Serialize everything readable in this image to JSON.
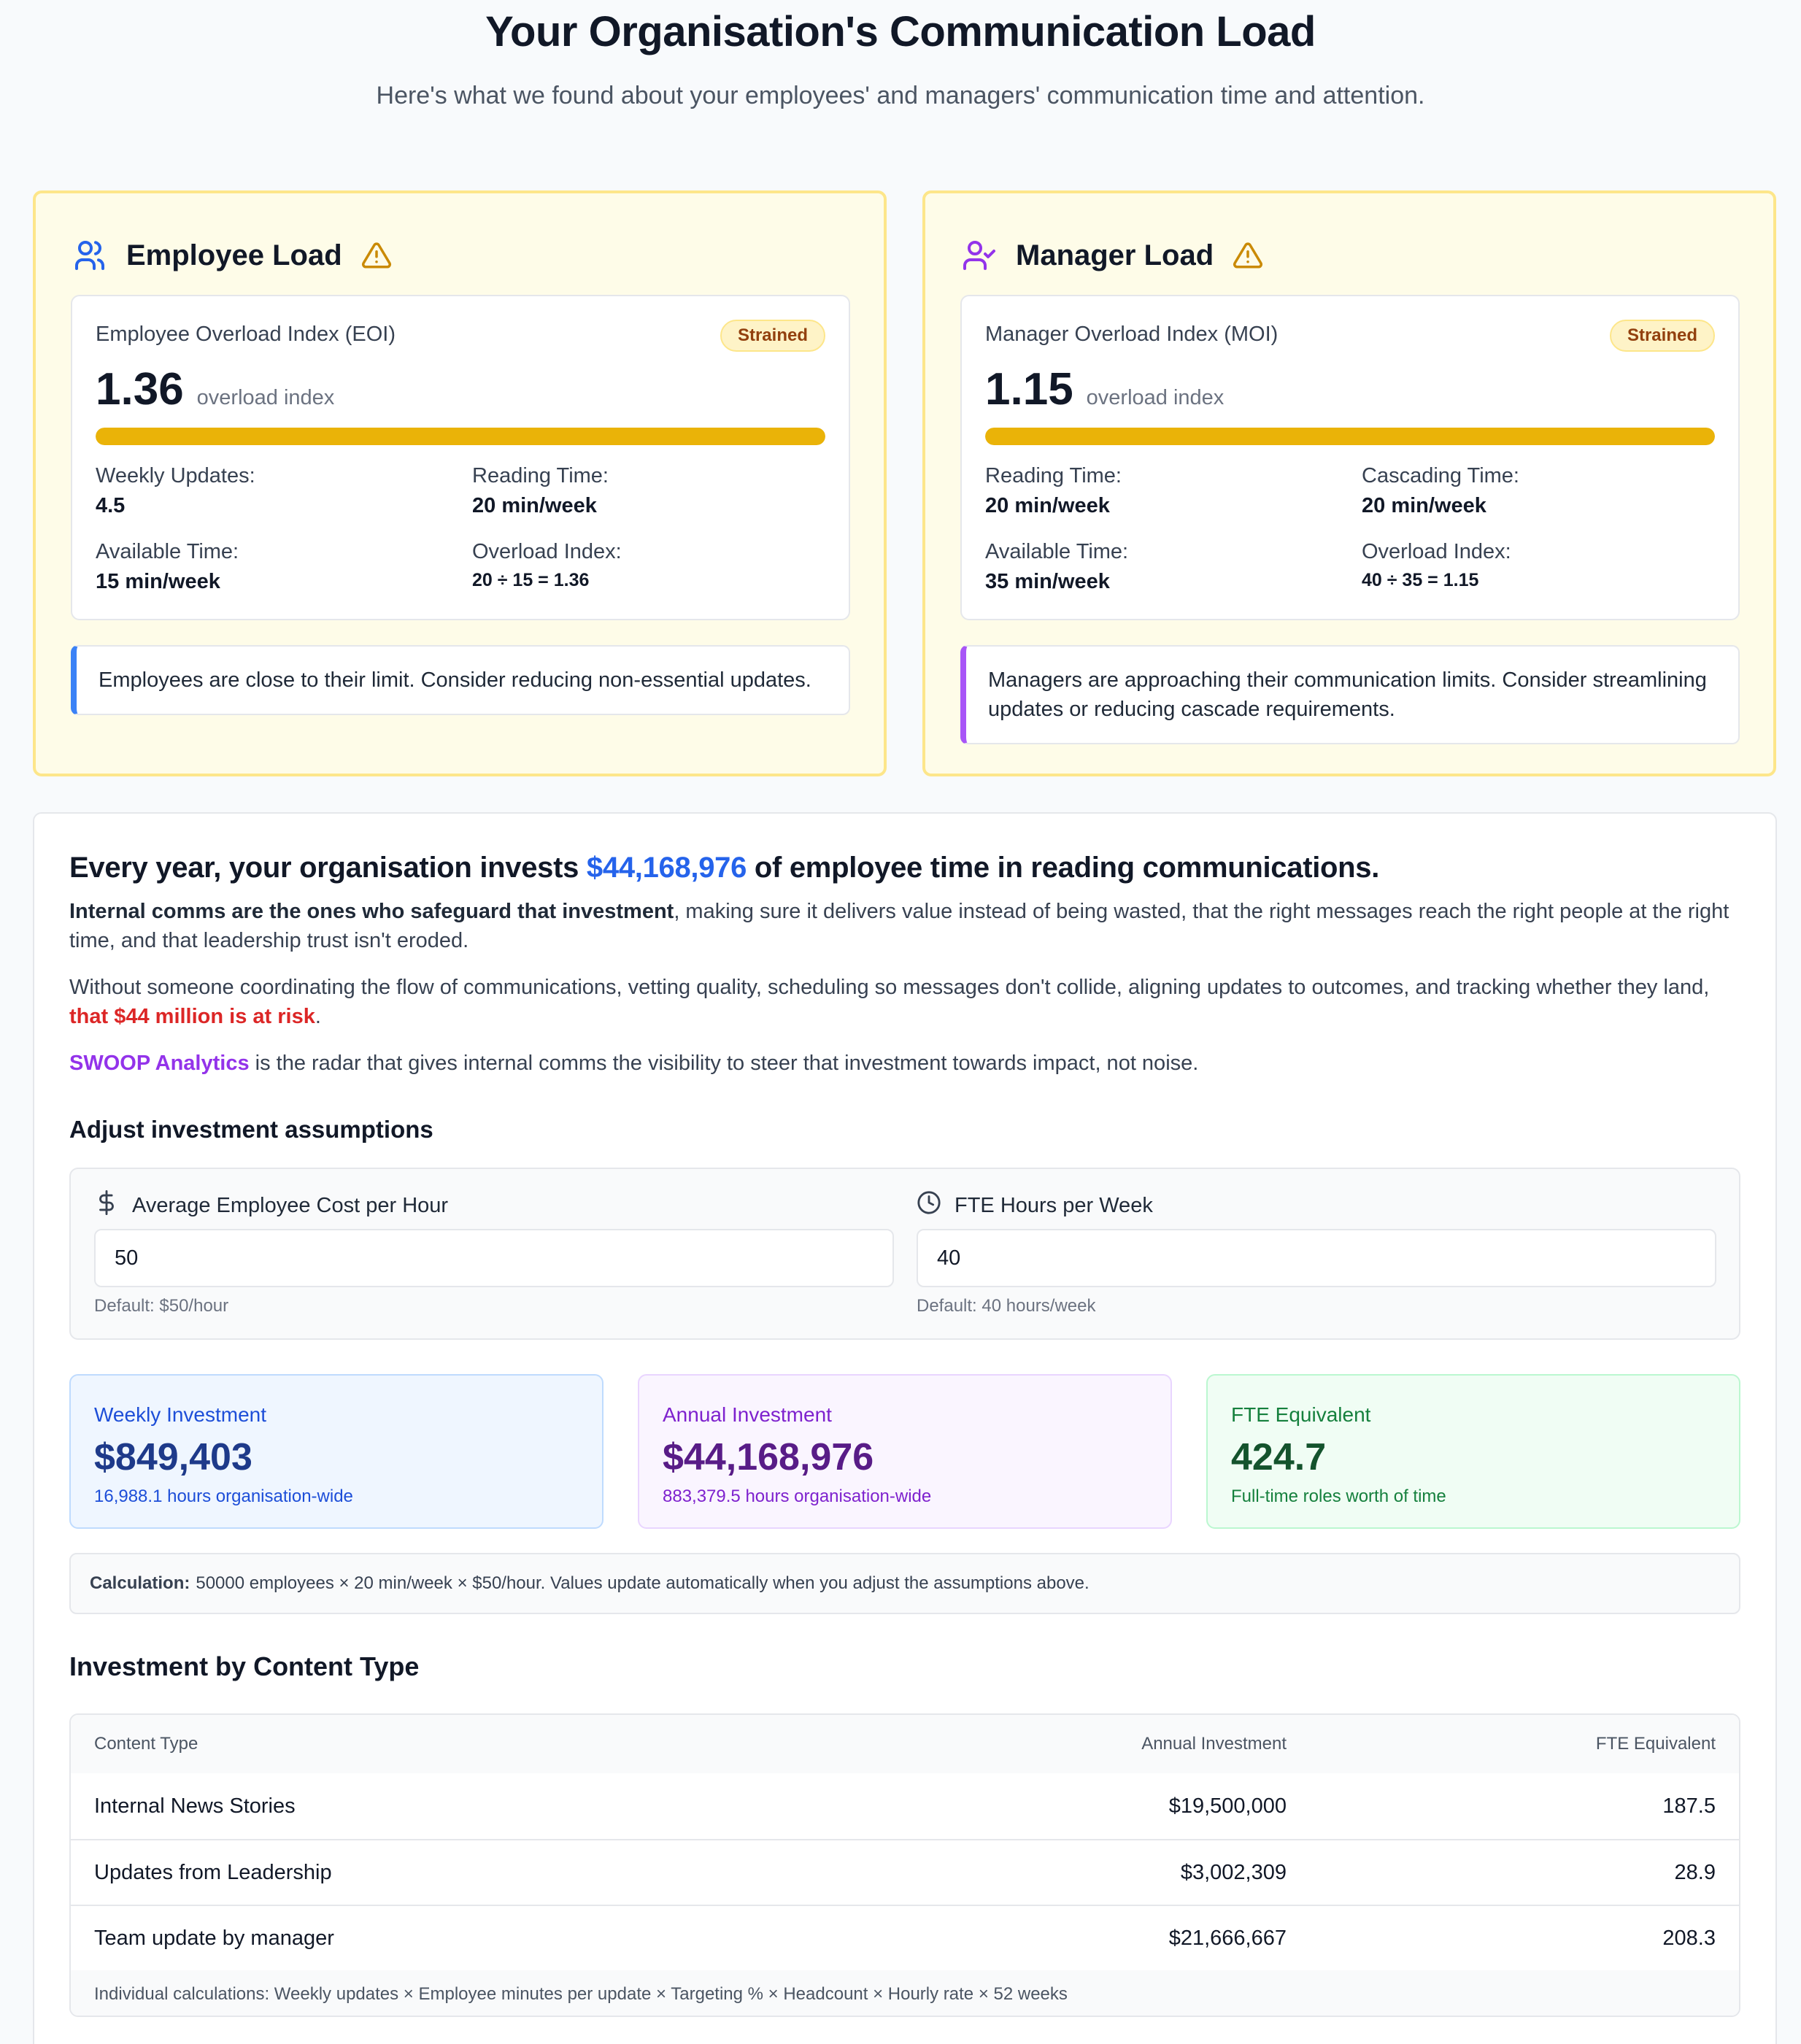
{
  "header": {
    "title": "Your Organisation's Communication Load",
    "subtitle": "Here's what we found about your employees' and managers' communication time and attention."
  },
  "colors": {
    "warning_yellow": "#eab308",
    "accent_blue": "#2563eb",
    "accent_purple": "#9333ea",
    "risk_red": "#dc2626",
    "success_green": "#15803d"
  },
  "employee_load": {
    "title": "Employee Load",
    "icon": "users-icon",
    "warning_icon": "warning-triangle-icon",
    "index_label": "Employee Overload Index (EOI)",
    "status": "Strained",
    "value": "1.36",
    "unit": "overload index",
    "bar_fill_fraction": 1.0,
    "stats": [
      {
        "label": "Weekly Updates:",
        "value": "4.5"
      },
      {
        "label": "Reading Time:",
        "value": "20 min/week"
      },
      {
        "label": "Available Time:",
        "value": "15 min/week"
      },
      {
        "label": "Overload Index:",
        "value": "20 ÷ 15 = 1.36"
      }
    ],
    "note": "Employees are close to their limit. Consider reducing non-essential updates."
  },
  "manager_load": {
    "title": "Manager Load",
    "icon": "user-check-icon",
    "warning_icon": "warning-triangle-icon",
    "index_label": "Manager Overload Index (MOI)",
    "status": "Strained",
    "value": "1.15",
    "unit": "overload index",
    "bar_fill_fraction": 1.0,
    "stats": [
      {
        "label": "Reading Time:",
        "value": "20 min/week"
      },
      {
        "label": "Cascading Time:",
        "value": "20 min/week"
      },
      {
        "label": "Available Time:",
        "value": "35 min/week"
      },
      {
        "label": "Overload Index:",
        "value": "40 ÷ 35 = 1.15"
      }
    ],
    "note": "Managers are approaching their communication limits. Consider streamlining updates or reducing cascade requirements."
  },
  "investment": {
    "headline_pre": "Every year, your organisation invests ",
    "headline_amount": "$44,168,976",
    "headline_post": " of employee time in reading communications.",
    "p1_bold": "Internal comms are the ones who safeguard that investment",
    "p1_rest": ", making sure it delivers value instead of being wasted, that the right messages reach the right people at the right time, and that leadership trust isn't eroded.",
    "p2_text": "Without someone coordinating the flow of communications, vetting quality, scheduling so messages don't collide, aligning updates to outcomes, and tracking whether they land, ",
    "p2_risk": "that $44 million is at risk",
    "p2_end": ".",
    "p3_brand": "SWOOP Analytics",
    "p3_rest": " is the radar that gives internal comms the visibility to steer that investment towards impact, not noise.",
    "adjust_title": "Adjust investment assumptions",
    "cost_field": {
      "icon": "dollar-icon",
      "label": "Average Employee Cost per Hour",
      "value": "50",
      "hint": "Default: $50/hour"
    },
    "hours_field": {
      "icon": "clock-icon",
      "label": "FTE Hours per Week",
      "value": "40",
      "hint": "Default: 40 hours/week"
    },
    "kpis": [
      {
        "label": "Weekly Investment",
        "value": "$849,403",
        "sub": "16,988.1 hours organisation-wide"
      },
      {
        "label": "Annual Investment",
        "value": "$44,168,976",
        "sub": "883,379.5 hours organisation-wide"
      },
      {
        "label": "FTE Equivalent",
        "value": "424.7",
        "sub": "Full-time roles worth of time"
      }
    ],
    "calc_label": "Calculation:",
    "calc_text": "50000 employees × 20 min/week × $50/hour. Values update automatically when you adjust the assumptions above."
  },
  "content_table": {
    "title": "Investment by Content Type",
    "headers": [
      "Content Type",
      "Annual Investment",
      "FTE Equivalent"
    ],
    "rows": [
      {
        "type": "Internal News Stories",
        "investment": "$19,500,000",
        "fte": "187.5"
      },
      {
        "type": "Updates from Leadership",
        "investment": "$3,002,309",
        "fte": "28.9"
      },
      {
        "type": "Team update by manager",
        "investment": "$21,666,667",
        "fte": "208.3"
      }
    ],
    "footer": "Individual calculations: Weekly updates × Employee minutes per update × Targeting % × Headcount × Hourly rate × 52 weeks"
  }
}
